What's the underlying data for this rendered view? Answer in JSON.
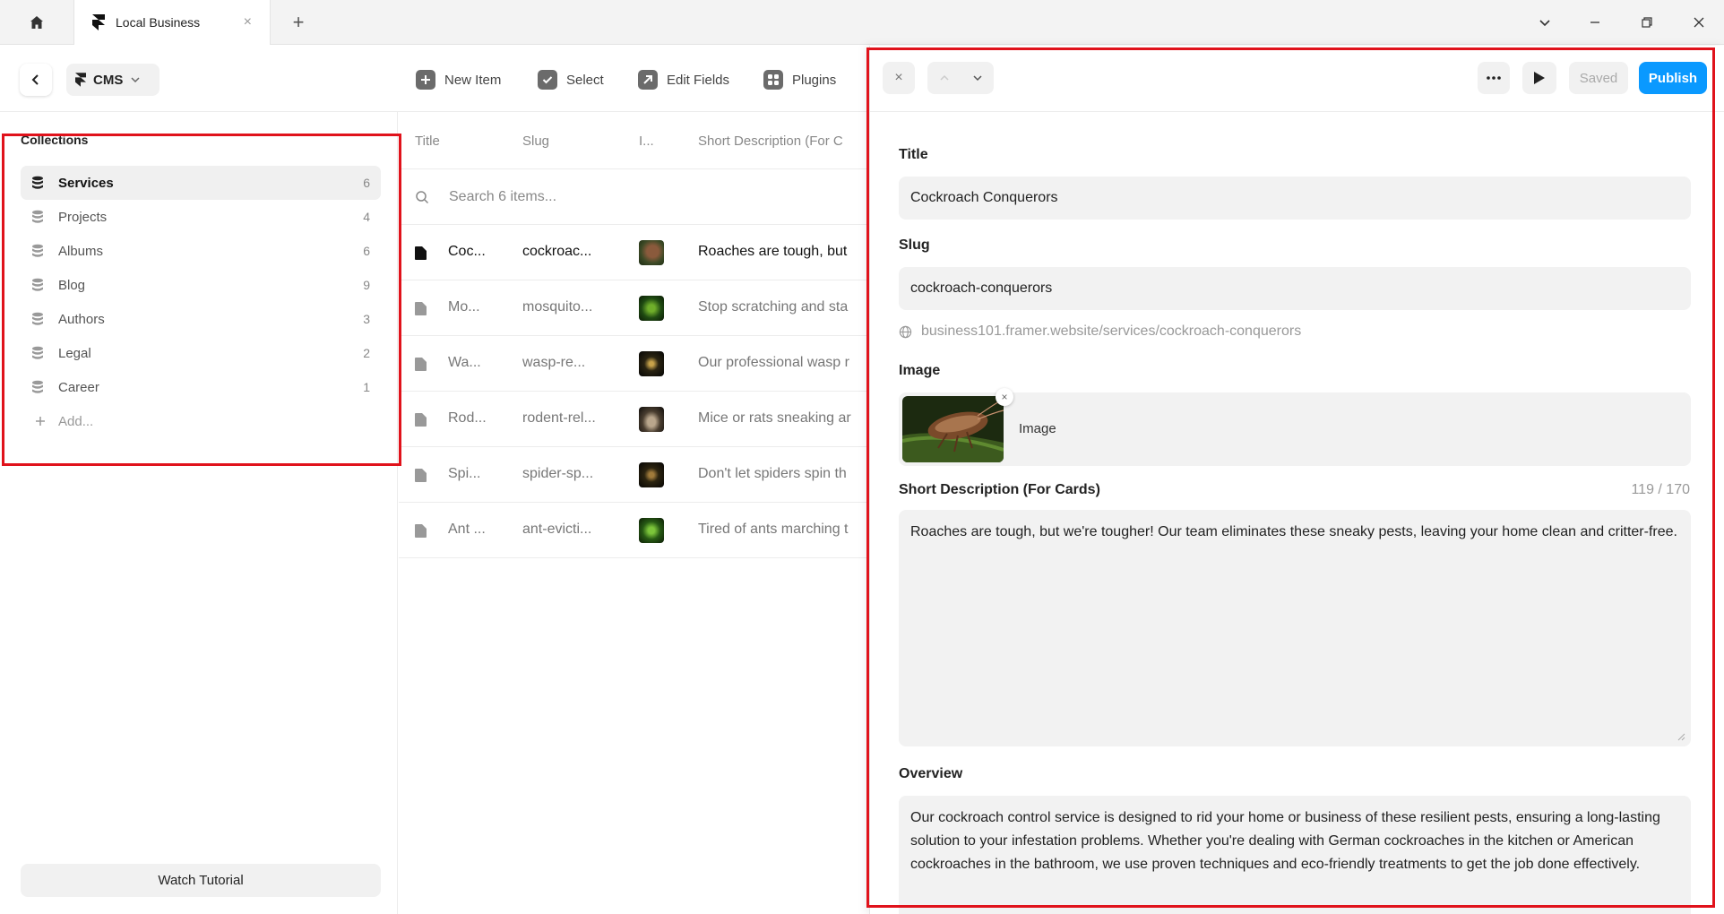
{
  "browser": {
    "tab_title": "Local Business",
    "tab_close": "×",
    "new_tab": "+"
  },
  "toolbar": {
    "cms_label": "CMS",
    "actions": [
      {
        "label": "New Item",
        "icon": "plus-square-icon"
      },
      {
        "label": "Select",
        "icon": "check-square-icon"
      },
      {
        "label": "Edit Fields",
        "icon": "edit-arrow-icon"
      },
      {
        "label": "Plugins",
        "icon": "plugins-grid-icon"
      }
    ]
  },
  "sidebar": {
    "heading": "Collections",
    "items": [
      {
        "name": "Services",
        "count": "6",
        "active": true
      },
      {
        "name": "Projects",
        "count": "4"
      },
      {
        "name": "Albums",
        "count": "6"
      },
      {
        "name": "Blog",
        "count": "9"
      },
      {
        "name": "Authors",
        "count": "3"
      },
      {
        "name": "Legal",
        "count": "2"
      },
      {
        "name": "Career",
        "count": "1"
      }
    ],
    "add_label": "Add...",
    "watch_tutorial": "Watch Tutorial"
  },
  "table": {
    "columns": [
      "Title",
      "Slug",
      "I...",
      "Short Description (For C"
    ],
    "search_placeholder": "Search 6 items...",
    "rows": [
      {
        "title": "Coc...",
        "slug": "cockroac...",
        "desc": "Roaches are tough, but",
        "active": true
      },
      {
        "title": "Mo...",
        "slug": "mosquito...",
        "desc": "Stop scratching and sta"
      },
      {
        "title": "Wa...",
        "slug": "wasp-re...",
        "desc": "Our professional wasp r"
      },
      {
        "title": "Rod...",
        "slug": "rodent-rel...",
        "desc": "Mice or rats sneaking ar"
      },
      {
        "title": "Spi...",
        "slug": "spider-sp...",
        "desc": "Don't let spiders spin th"
      },
      {
        "title": "Ant ...",
        "slug": "ant-evicti...",
        "desc": "Tired of ants marching t"
      }
    ]
  },
  "detail": {
    "close": "×",
    "saved_label": "Saved",
    "publish_label": "Publish",
    "title_label": "Title",
    "title_value": "Cockroach Conquerors",
    "slug_label": "Slug",
    "slug_value": "cockroach-conquerors",
    "url": "business101.framer.website/services/cockroach-conquerors",
    "image_label": "Image",
    "image_caption": "Image",
    "image_remove": "×",
    "short_desc_label": "Short Description (For Cards)",
    "short_desc_count": "119 / 170",
    "short_desc_value": "Roaches are tough, but we're tougher! Our team eliminates these sneaky pests, leaving your home clean and critter-free.",
    "overview_label": "Overview",
    "overview_value": "Our cockroach control service is designed to rid your home or business of these resilient pests, ensuring a long-lasting solution to your infestation problems. Whether you're dealing with German cockroaches in the kitchen or American cockroaches in the bathroom, we use proven techniques and eco-friendly treatments to get the job done effectively."
  },
  "colors": {
    "accent": "#0a99ff",
    "annotation": "#e0121b"
  }
}
